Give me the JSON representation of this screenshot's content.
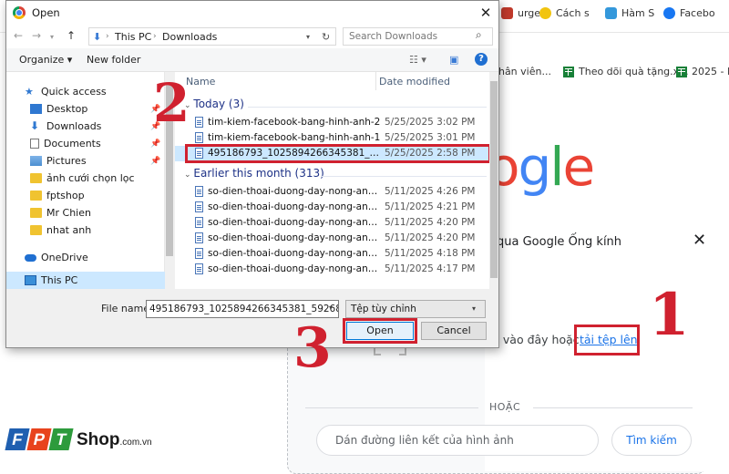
{
  "browser": {
    "bookmarks": [
      {
        "label": "urger",
        "color": "#c0392b"
      },
      {
        "label": "Cách s",
        "color": "#f1c40f"
      },
      {
        "label": "Hàm S",
        "color": "#3498db"
      },
      {
        "label": "Facebo",
        "color": "#1877f2"
      }
    ],
    "bookmarks2": [
      {
        "label": "nhân viên..."
      },
      {
        "label": "Theo dõi quà tặng.x..."
      },
      {
        "label": "2025 - Mu"
      }
    ],
    "logo_text": "ogle",
    "lens_title": "qua Google Ống kính",
    "close_glyph": "✕",
    "drop_text": "n vào đây hoặc",
    "upload_link": "tải tệp lên",
    "or_text": "HOẶC",
    "url_placeholder": "Dán đường liên kết của hình ảnh",
    "search_button": "Tìm kiếm",
    "colors": {
      "google_blue": "#4285f4",
      "google_red": "#ea4335",
      "google_yellow": "#fbbc05",
      "google_green": "#34a853"
    }
  },
  "annotations": {
    "n1": "1",
    "n2": "2",
    "n3": "3",
    "color": "#d0212f"
  },
  "brand": {
    "tiles": [
      "F",
      "P",
      "T"
    ],
    "shop": "Shop",
    "domain": ".com.vn"
  },
  "dialog": {
    "title": "Open",
    "close_glyph": "✕",
    "breadcrumb": [
      "This PC",
      "Downloads"
    ],
    "search_placeholder": "Search Downloads",
    "toolbar": {
      "organize": "Organize ▾",
      "new_folder": "New folder"
    },
    "nav_items": [
      {
        "label": "Quick access",
        "icon": "star-icon"
      },
      {
        "label": "Desktop",
        "icon": "desktop-icon",
        "pinned": true
      },
      {
        "label": "Downloads",
        "icon": "download-icon",
        "pinned": true
      },
      {
        "label": "Documents",
        "icon": "document-icon",
        "pinned": true
      },
      {
        "label": "Pictures",
        "icon": "pictures-icon",
        "pinned": true
      },
      {
        "label": "ảnh cưới chọn lọc",
        "icon": "folder-icon"
      },
      {
        "label": "fptshop",
        "icon": "folder-icon"
      },
      {
        "label": "Mr Chien",
        "icon": "folder-icon"
      },
      {
        "label": "nhat anh",
        "icon": "folder-icon"
      },
      {
        "label": "OneDrive",
        "icon": "cloud-icon"
      },
      {
        "label": "This PC",
        "icon": "pc-icon",
        "selected": true
      }
    ],
    "columns": {
      "name": "Name",
      "date": "Date modified"
    },
    "groups": [
      {
        "label": "Today (3)",
        "files": [
          {
            "name": "tim-kiem-facebook-bang-hinh-anh-2",
            "date": "5/25/2025 3:02 PM"
          },
          {
            "name": "tim-kiem-facebook-bang-hinh-anh-1",
            "date": "5/25/2025 3:01 PM"
          },
          {
            "name": "495186793_1025894266345381_592689147...",
            "date": "5/25/2025 2:58 PM",
            "selected": true
          }
        ]
      },
      {
        "label": "Earlier this month (313)",
        "files": [
          {
            "name": "so-dien-thoai-duong-day-nong-an-ninh...",
            "date": "5/11/2025 4:26 PM"
          },
          {
            "name": "so-dien-thoai-duong-day-nong-an-ninh...",
            "date": "5/11/2025 4:21 PM"
          },
          {
            "name": "so-dien-thoai-duong-day-nong-an-ninh...",
            "date": "5/11/2025 4:20 PM"
          },
          {
            "name": "so-dien-thoai-duong-day-nong-an-ninh...",
            "date": "5/11/2025 4:20 PM"
          },
          {
            "name": "so-dien-thoai-duong-day-nong-an-ninh...",
            "date": "5/11/2025 4:18 PM"
          },
          {
            "name": "so-dien-thoai-duong-day-nong-an-ninh...",
            "date": "5/11/2025 4:17 PM"
          }
        ]
      }
    ],
    "file_name_label": "File name:",
    "file_name_value": "495186793_1025894266345381_5926891474502",
    "file_type": "Tệp tùy chỉnh",
    "open_button": "Open",
    "cancel_button": "Cancel"
  }
}
